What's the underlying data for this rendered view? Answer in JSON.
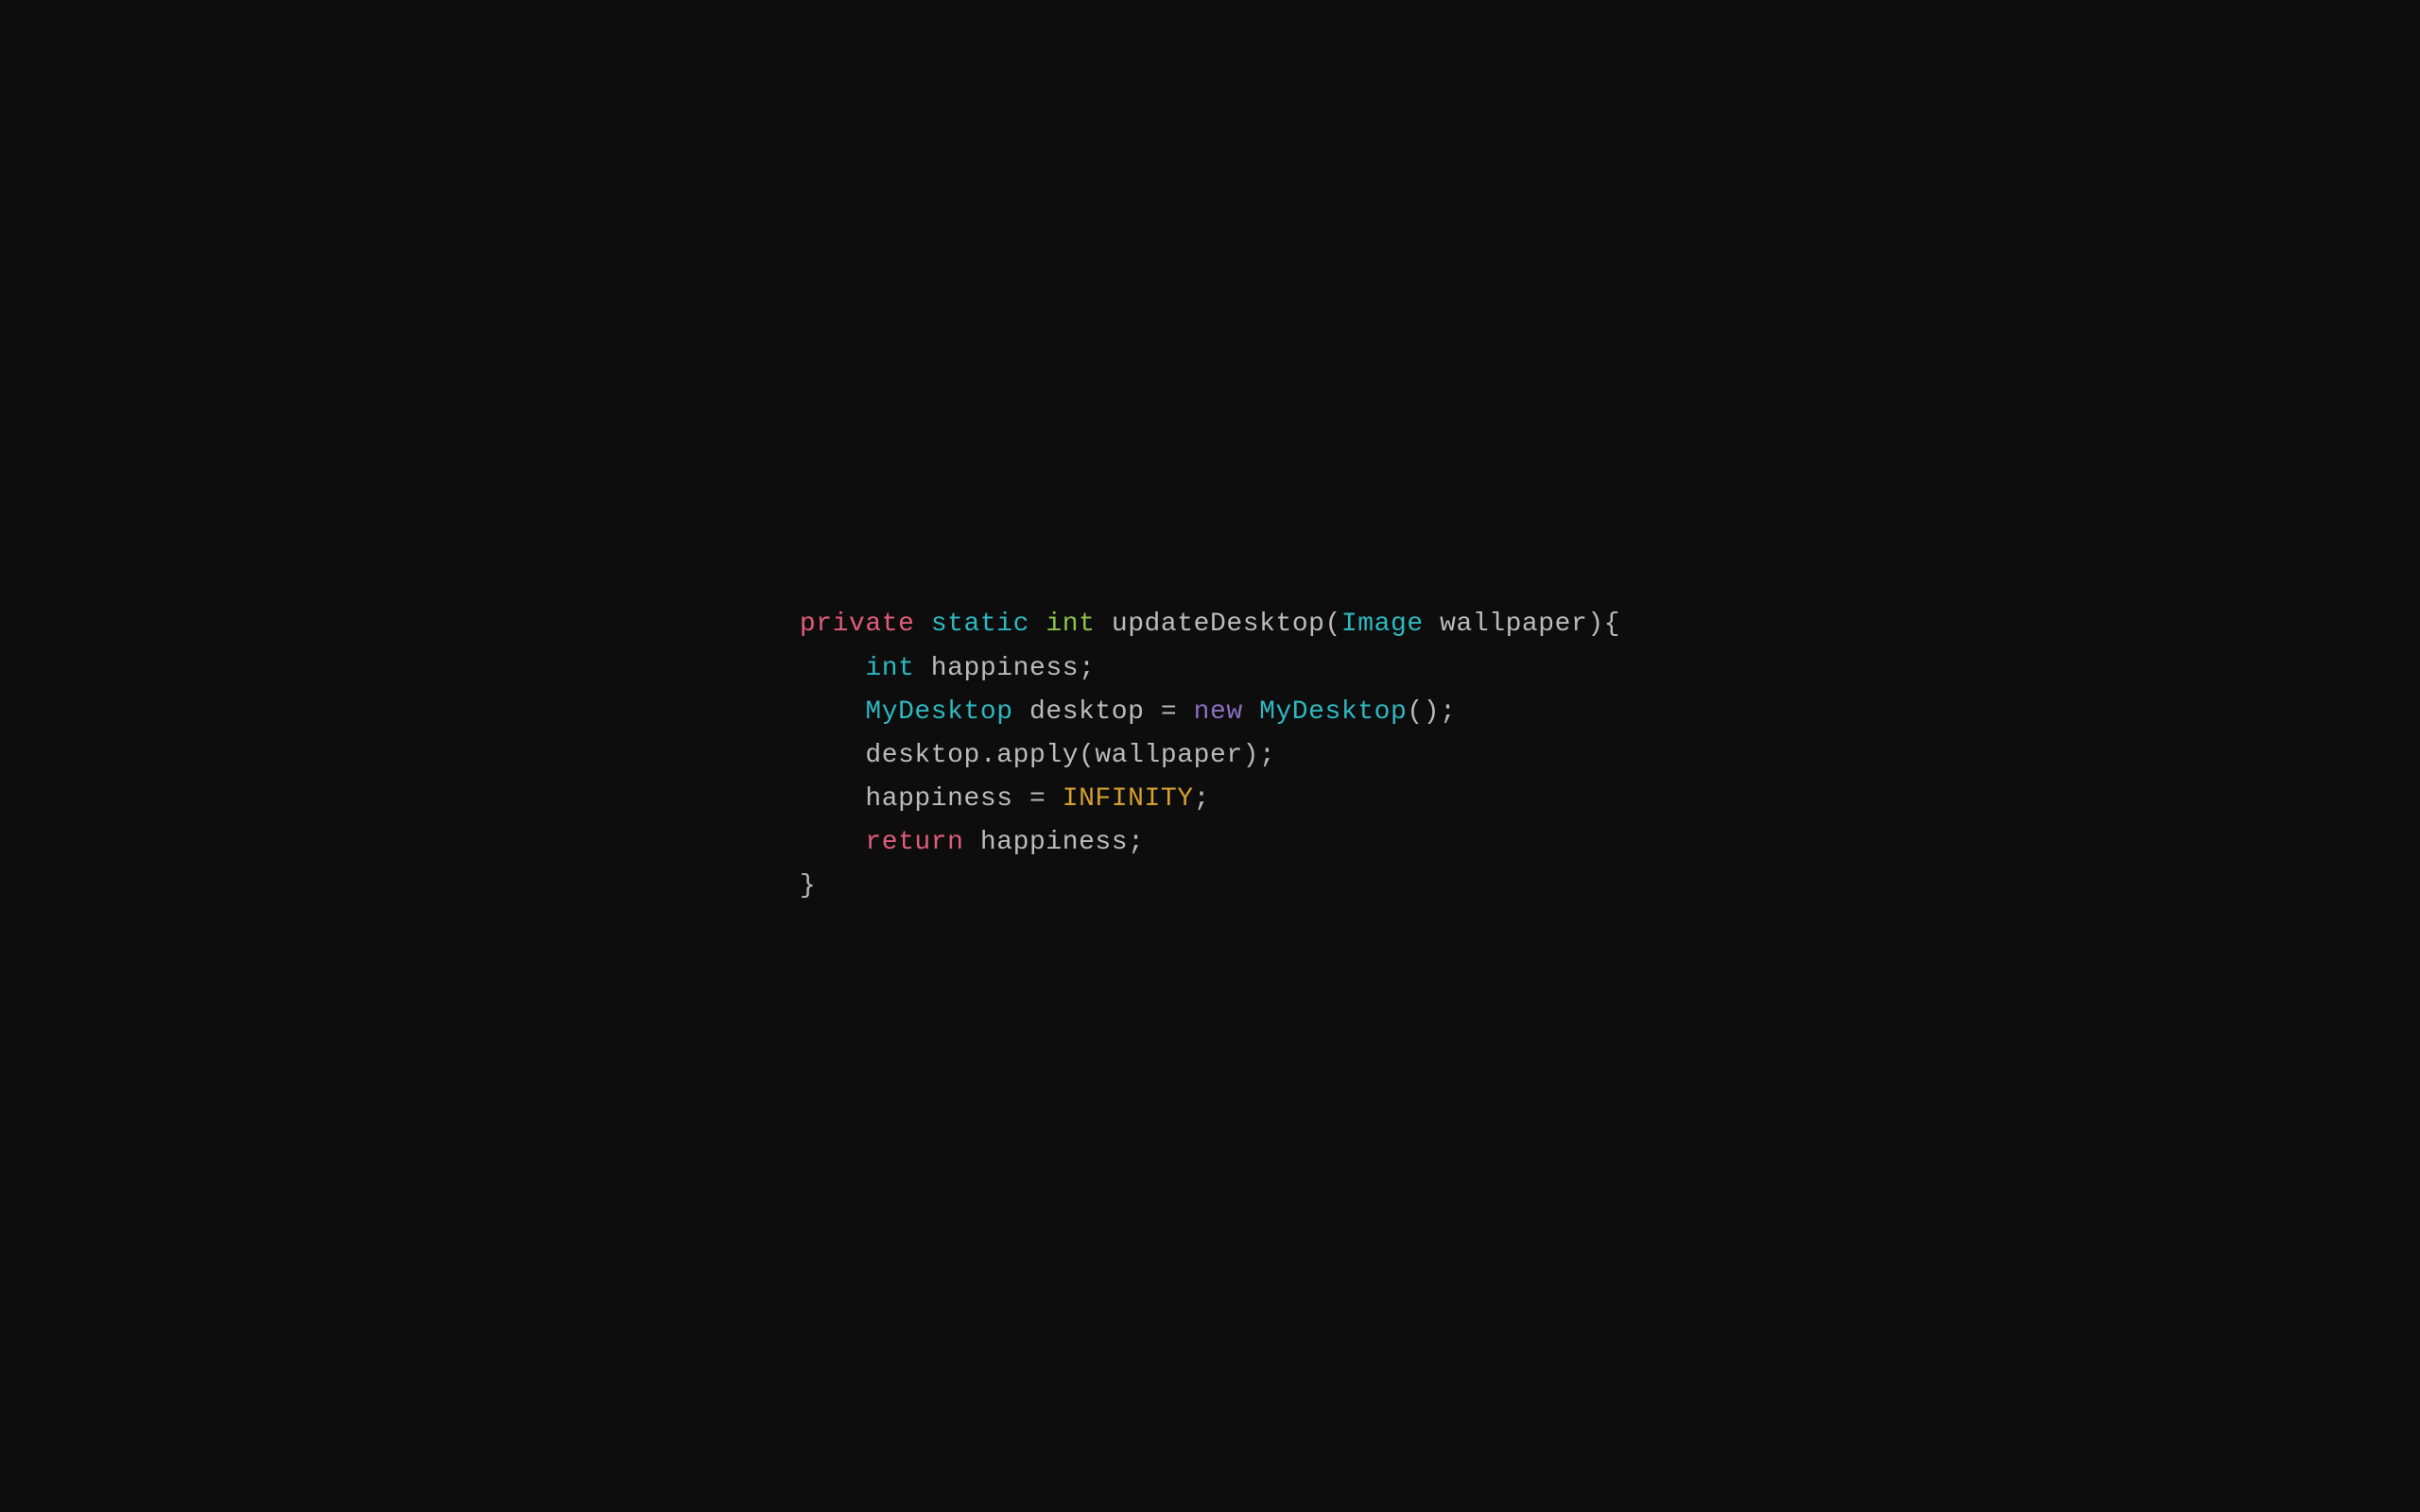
{
  "code": {
    "lines": [
      {
        "id": "line1",
        "parts": [
          {
            "text": "private",
            "class": "kw-private"
          },
          {
            "text": " ",
            "class": "text-dim"
          },
          {
            "text": "static",
            "class": "kw-static"
          },
          {
            "text": " ",
            "class": "text-dim"
          },
          {
            "text": "int",
            "class": "kw-int"
          },
          {
            "text": " updateDesktop(",
            "class": "text-dim"
          },
          {
            "text": "Image",
            "class": "kw-image"
          },
          {
            "text": " wallpaper){",
            "class": "text-dim"
          }
        ]
      },
      {
        "id": "line2",
        "parts": [
          {
            "text": "    ",
            "class": "text-dim"
          },
          {
            "text": "int",
            "class": "kw-int2"
          },
          {
            "text": " happiness;",
            "class": "text-dim"
          }
        ]
      },
      {
        "id": "line3",
        "parts": [
          {
            "text": "    ",
            "class": "text-dim"
          },
          {
            "text": "MyDesktop",
            "class": "kw-mydesktop"
          },
          {
            "text": " desktop = ",
            "class": "text-dim"
          },
          {
            "text": "new",
            "class": "kw-new"
          },
          {
            "text": " ",
            "class": "text-dim"
          },
          {
            "text": "MyDesktop",
            "class": "kw-mydesktop"
          },
          {
            "text": "();",
            "class": "text-dim"
          }
        ]
      },
      {
        "id": "line4",
        "parts": [
          {
            "text": "    desktop.apply(wallpaper);",
            "class": "text-dim"
          }
        ]
      },
      {
        "id": "line5",
        "parts": [
          {
            "text": "    happiness = ",
            "class": "text-dim"
          },
          {
            "text": "INFINITY",
            "class": "kw-infinity"
          },
          {
            "text": ";",
            "class": "text-dim"
          }
        ]
      },
      {
        "id": "line6",
        "parts": [
          {
            "text": "    ",
            "class": "text-dim"
          },
          {
            "text": "return",
            "class": "kw-return"
          },
          {
            "text": " happiness;",
            "class": "text-dim"
          }
        ]
      },
      {
        "id": "line7",
        "parts": [
          {
            "text": "}",
            "class": "text-dim"
          }
        ]
      }
    ]
  }
}
